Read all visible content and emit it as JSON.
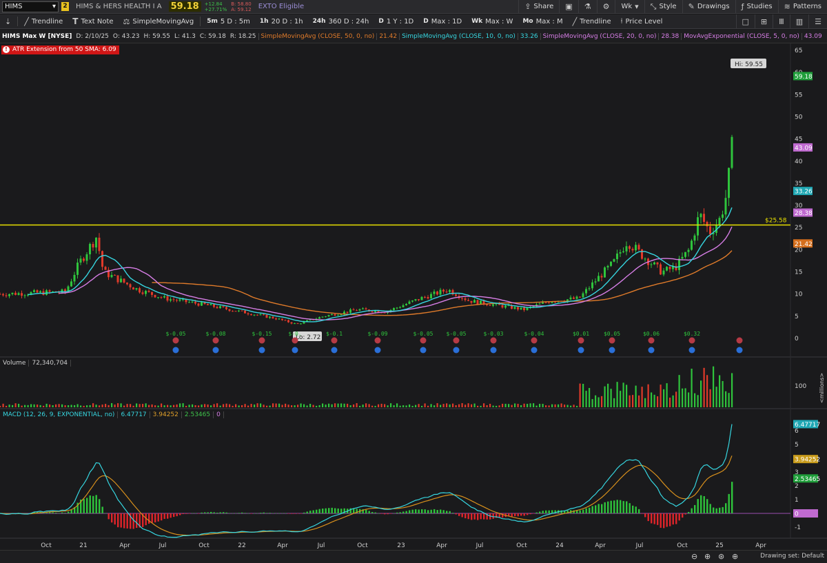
{
  "header": {
    "symbol": "HIMS",
    "link_badge": "2",
    "company": "HIMS & HERS HEALTH I A",
    "last": "59.18",
    "change": "+12.84",
    "change_pct": "+27.71%",
    "bid": "B: 58.80",
    "ask": "A: 59.12",
    "exto": "EXTO Eligible",
    "buttons": [
      "Share",
      "Wk",
      "Style",
      "Drawings",
      "Studies",
      "Patterns"
    ]
  },
  "toolbar": {
    "items": [
      "Trendline",
      "Text Note",
      "SimpleMovingAvg"
    ],
    "periods": [
      {
        "k": "5m",
        "v": "5 D : 5m"
      },
      {
        "k": "1h",
        "v": "20 D : 1h"
      },
      {
        "k": "24h",
        "v": "360 D : 24h"
      },
      {
        "k": "D",
        "v": "1 Y : 1D"
      },
      {
        "k": "D",
        "v": "Max : 1D"
      },
      {
        "k": "Wk",
        "v": "Max : W"
      },
      {
        "k": "Mo",
        "v": "Max : M"
      }
    ],
    "right_items": [
      "Trendline",
      "Price Level"
    ]
  },
  "studies": {
    "title": "HIMS Max W [NYSE]",
    "date": "D: 2/10/25",
    "open": "O: 43.23",
    "high": "H: 59.55",
    "low": "L: 41.3",
    "close": "C: 59.18",
    "range": "R: 18.25",
    "list": [
      {
        "label": "SimpleMovingAvg (CLOSE, 50, 0, no)",
        "value": "21.42",
        "color": "#e07b2a"
      },
      {
        "label": "SimpleMovingAvg (CLOSE, 10, 0, no)",
        "value": "33.26",
        "color": "#36d6e0"
      },
      {
        "label": "SimpleMovingAvg (CLOSE, 20, 0, no)",
        "value": "28.38",
        "color": "#d77ee6"
      },
      {
        "label": "MovAvgExponential (CLOSE, 5, 0, no)",
        "value": "43.09",
        "color": "#d77ee6"
      }
    ]
  },
  "atr_label": "ATR Extension from 50 SMA: 6.09",
  "hi_label": "Hi: 59.55",
  "lo_label": "Lo: 2.72",
  "level_label": "$25.58",
  "earnings": [
    "$-0.05",
    "$-0.08",
    "$-0.15",
    "$-0.",
    "$-0.1",
    "$-0.09",
    "$-0.05",
    "$-0.05",
    "$-0.03",
    "$-0.04",
    "$0.01",
    "$0.05",
    "$0.06",
    "$0.32"
  ],
  "volume": {
    "label": "Volume",
    "value": "72,340,704",
    "axis_unit": "<millions>",
    "tick": "100"
  },
  "macd": {
    "label": "MACD (12, 26, 9, EXPONENTIAL, no)",
    "v1": "6.47717",
    "v2": "3.94252",
    "v3": "2.53465",
    "v4": "0"
  },
  "price_ticks": [
    "65",
    "60",
    "55",
    "50",
    "45",
    "40",
    "35",
    "30",
    "25",
    "20",
    "15",
    "10",
    "5",
    "0"
  ],
  "price_tags": [
    {
      "v": "59.18",
      "color": "#1f9e3a"
    },
    {
      "v": "43.09",
      "color": "#c06ad0"
    },
    {
      "v": "33.26",
      "color": "#1fa7b3"
    },
    {
      "v": "28.38",
      "color": "#c06ad0"
    },
    {
      "v": "21.42",
      "color": "#d46e1c"
    }
  ],
  "macd_ticks": [
    "6",
    "5",
    "4",
    "3",
    "2",
    "1",
    "-1"
  ],
  "macd_tags": [
    {
      "v": "6.47717",
      "color": "#1fa7b3"
    },
    {
      "v": "3.94252",
      "color": "#c89b1a"
    },
    {
      "v": "2.53465",
      "color": "#1f9e3a"
    },
    {
      "v": "0",
      "color": "#c06ad0"
    }
  ],
  "x_labels": [
    "Oct",
    "21",
    "Apr",
    "Jul",
    "Oct",
    "22",
    "Apr",
    "Jul",
    "Oct",
    "23",
    "Apr",
    "Jul",
    "Oct",
    "24",
    "Apr",
    "Jul",
    "Oct",
    "25",
    "Apr"
  ],
  "footer": {
    "drawing_set": "Drawing set: Default"
  },
  "chart_data": {
    "type": "line",
    "title": "HIMS Max W [NYSE]",
    "x": [
      "Oct",
      "21",
      "Apr",
      "Jul",
      "Oct",
      "22",
      "Apr",
      "Jul",
      "Oct",
      "23",
      "Apr",
      "Jul",
      "Oct",
      "24",
      "Apr",
      "Jul",
      "Oct",
      "25"
    ],
    "series": [
      {
        "name": "HIMS",
        "values": [
          10,
          13,
          15,
          9,
          7,
          6,
          4,
          5,
          6,
          7,
          10,
          7,
          6,
          8,
          15,
          17,
          25,
          59.18
        ]
      },
      {
        "name": "SimpleMovingAvg (CLOSE, 50, 0, no)",
        "values": [
          null,
          null,
          11,
          12,
          11,
          9,
          7,
          6,
          5.5,
          6,
          7,
          7,
          7,
          7,
          9,
          10,
          14,
          21.42
        ]
      }
    ],
    "ylim": [
      0,
      65
    ],
    "horizontal_line": 25.58,
    "high": 59.55,
    "low": 2.72
  }
}
